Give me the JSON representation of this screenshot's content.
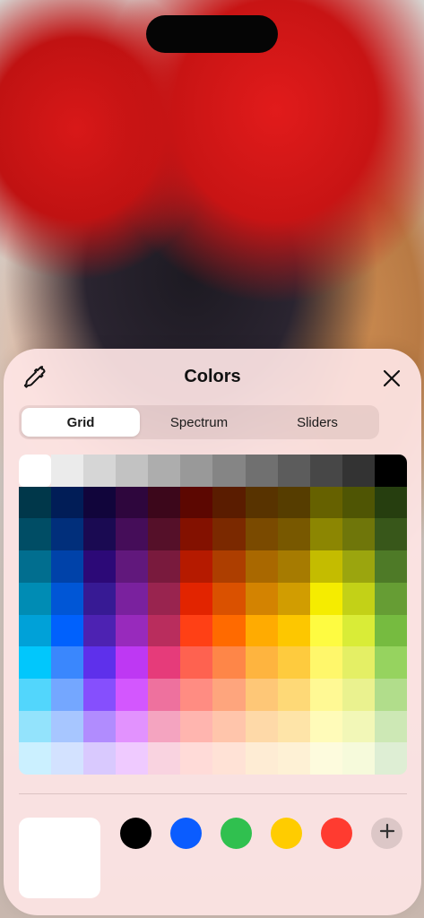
{
  "panel": {
    "title": "Colors",
    "eyedropper_icon": "eyedropper-icon",
    "close_icon": "close-icon"
  },
  "tabs": [
    {
      "label": "Grid",
      "active": true
    },
    {
      "label": "Spectrum",
      "active": false
    },
    {
      "label": "Sliders",
      "active": false
    }
  ],
  "grid": {
    "selected": {
      "row": 0,
      "col": 0
    },
    "rows": [
      [
        "#ffffff",
        "#ebebeb",
        "#d6d6d6",
        "#c2c2c2",
        "#adadad",
        "#999999",
        "#858585",
        "#707070",
        "#5c5c5c",
        "#474747",
        "#333333",
        "#000000"
      ],
      [
        "#00374a",
        "#011d57",
        "#11053b",
        "#2e063d",
        "#3c071b",
        "#5c0701",
        "#5a1c00",
        "#583300",
        "#563d00",
        "#666100",
        "#4f5504",
        "#263e0f"
      ],
      [
        "#004d65",
        "#012f7b",
        "#1a0a52",
        "#450d59",
        "#551029",
        "#831100",
        "#7b2900",
        "#7a4a00",
        "#785800",
        "#8c8602",
        "#6f760a",
        "#38571a"
      ],
      [
        "#016e8f",
        "#0042a9",
        "#2c0977",
        "#61187c",
        "#791a3d",
        "#b51a00",
        "#ad3e00",
        "#a96800",
        "#a67b01",
        "#c4bc00",
        "#9ba50e",
        "#4e7a27"
      ],
      [
        "#008cb4",
        "#0056d6",
        "#371a94",
        "#7a219e",
        "#99244f",
        "#e22400",
        "#da5100",
        "#d38301",
        "#d19d01",
        "#f5ec00",
        "#c3d117",
        "#669d34"
      ],
      [
        "#00a1d8",
        "#0061fd",
        "#4d22b2",
        "#982abc",
        "#b92d5d",
        "#ff4015",
        "#ff6a00",
        "#ffab01",
        "#fdc700",
        "#fefb41",
        "#d9ec37",
        "#76bb40"
      ],
      [
        "#01c7fc",
        "#3a87fd",
        "#5e30eb",
        "#be38f3",
        "#e63b7a",
        "#fe6250",
        "#fe8648",
        "#feb43f",
        "#fecb3e",
        "#fff76b",
        "#e4ef65",
        "#96d35f"
      ],
      [
        "#52d6fc",
        "#74a7ff",
        "#864ffd",
        "#d357fe",
        "#ee719e",
        "#ff8c82",
        "#fea57d",
        "#fec777",
        "#fed977",
        "#fff994",
        "#eaf28f",
        "#b1dd8b"
      ],
      [
        "#93e3fc",
        "#a7c6ff",
        "#b18cfe",
        "#e292fe",
        "#f4a4c0",
        "#ffb5af",
        "#ffc5ab",
        "#fed9a8",
        "#fee4a8",
        "#fffbb9",
        "#f2f7b7",
        "#cde8b5"
      ],
      [
        "#cbf0ff",
        "#d3e2ff",
        "#d9c9fe",
        "#efcaff",
        "#f9d3e0",
        "#ffdbd8",
        "#ffe2d6",
        "#feecd4",
        "#fef1d5",
        "#fdfbdd",
        "#f6fadb",
        "#deeed4"
      ]
    ]
  },
  "current_color": "#ffffff",
  "swatches": [
    {
      "name": "black",
      "color": "#000000"
    },
    {
      "name": "blue",
      "color": "#0a5cff"
    },
    {
      "name": "green",
      "color": "#30c04f"
    },
    {
      "name": "yellow",
      "color": "#ffcc00"
    },
    {
      "name": "red",
      "color": "#ff3b30"
    }
  ],
  "add_icon": "plus-icon"
}
